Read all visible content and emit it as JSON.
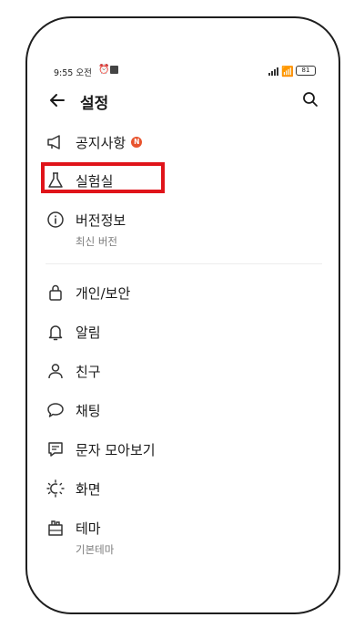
{
  "status_bar": {
    "time": "9:55 오전",
    "battery": "81"
  },
  "header": {
    "title": "설정"
  },
  "menu": {
    "notice": {
      "label": "공지사항",
      "badge": "N"
    },
    "lab": {
      "label": "실험실"
    },
    "version": {
      "label": "버전정보",
      "sub": "최신 버전"
    },
    "privacy": {
      "label": "개인/보안"
    },
    "alarm": {
      "label": "알림"
    },
    "friends": {
      "label": "친구"
    },
    "chat": {
      "label": "채팅"
    },
    "sms": {
      "label": "문자 모아보기"
    },
    "screen": {
      "label": "화면"
    },
    "theme": {
      "label": "테마",
      "sub": "기본테마"
    }
  },
  "colors": {
    "highlight": "#e0141a",
    "badge": "#e8532d"
  },
  "icons": {
    "notice": "megaphone-icon",
    "lab": "flask-icon",
    "version": "info-icon",
    "privacy": "lock-icon",
    "alarm": "bell-icon",
    "friends": "person-icon",
    "chat": "chat-bubble-icon",
    "sms": "sms-icon",
    "screen": "brightness-icon",
    "theme": "theme-icon"
  }
}
